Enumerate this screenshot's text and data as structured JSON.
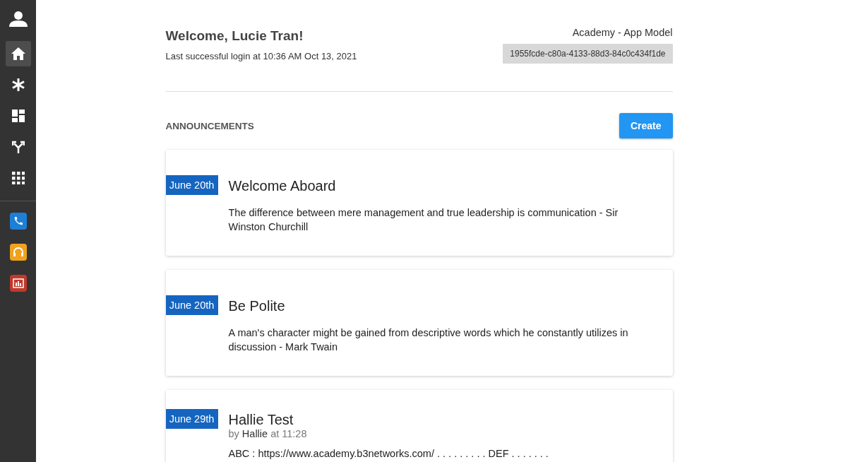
{
  "sidebar": {
    "items": [
      {
        "kind": "home",
        "selected": true
      },
      {
        "kind": "asterisk",
        "selected": false
      },
      {
        "kind": "dashboard",
        "selected": false
      },
      {
        "kind": "fork",
        "selected": false
      },
      {
        "kind": "apps",
        "selected": false
      }
    ],
    "apps": [
      {
        "kind": "phone",
        "color": "#1e7fd6"
      },
      {
        "kind": "headset",
        "color": "#f0a21f"
      },
      {
        "kind": "report",
        "color": "#c0392b"
      }
    ]
  },
  "header": {
    "title": "Welcome, Lucie Tran!",
    "last_login": "Last successful login at 10:36 AM Oct 13, 2021",
    "org": "Academy - App Model",
    "org_id": "1955fcde-c80a-4133-88d3-84c0c434f1de"
  },
  "announcements": {
    "heading": "ANNOUNCEMENTS",
    "create_button": "Create",
    "items": [
      {
        "date": "June 20th",
        "title": "Welcome Aboard",
        "body": "The difference between mere management and true leadership is communication - Sir Winston Churchill"
      },
      {
        "date": "June 20th",
        "title": "Be Polite",
        "body": "A man's character might be gained from descriptive words which he constantly utilizes in discussion - Mark Twain"
      },
      {
        "date": "June 29th",
        "title": "Hallie Test",
        "byline": {
          "prefix": "by",
          "author": "Hallie",
          "suffix": "at 11:28"
        },
        "body": "ABC : https://www.academy.b3networks.com/ . . . . . . . . . DEF . . . . . . ."
      }
    ]
  }
}
